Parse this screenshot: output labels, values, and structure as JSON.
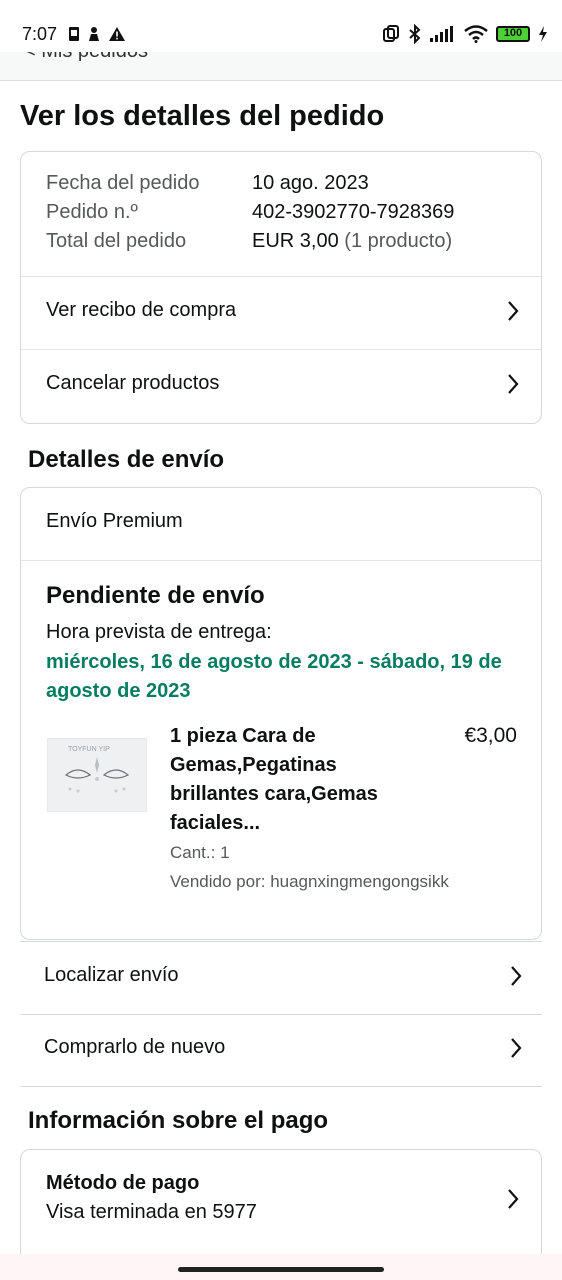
{
  "status": {
    "time": "7:07",
    "battery": "100",
    "left_icons": [
      "sim-icon",
      "person-icon",
      "warning-icon"
    ],
    "right_icons": [
      "nfc-icon",
      "bluetooth-icon",
      "signal-icon",
      "wifi-icon",
      "battery-icon",
      "charging-icon"
    ]
  },
  "nav": {
    "back_label": "< Mis pedidos"
  },
  "page": {
    "title": "Ver los detalles del pedido"
  },
  "summary": {
    "date_label": "Fecha del pedido",
    "date_value": "10 ago. 2023",
    "order_label": "Pedido n.º",
    "order_value": "402-3902770-7928369",
    "total_label": "Total del pedido",
    "total_value": "EUR 3,00",
    "total_count": "(1 producto)",
    "receipt_link": "Ver recibo de compra",
    "cancel_link": "Cancelar productos"
  },
  "shipping": {
    "section_title": "Detalles de envío",
    "type": "Envío Premium",
    "status": "Pendiente de envío",
    "eta_label": "Hora prevista de entrega:",
    "eta_date": "miércoles, 16 de agosto de 2023 - sábado, 19 de agosto de 2023",
    "product": {
      "title": "1 pieza Cara de Gemas,Pegatinas brillantes cara,Gemas faciales...",
      "price": "€3,00",
      "qty": "Cant.: 1",
      "seller": "Vendido por: huagnxingmengongsikk",
      "image_text": "TOYFUN YIP"
    },
    "track_link": "Localizar envío",
    "buy_again_link": "Comprarlo de nuevo"
  },
  "payment": {
    "section_title": "Información sobre el pago",
    "method_title": "Método de pago",
    "method_value": "Visa terminada en 5977"
  },
  "colors": {
    "accent_green": "#067d62",
    "battery_green": "#4cd137",
    "border": "#d5d9d9"
  }
}
